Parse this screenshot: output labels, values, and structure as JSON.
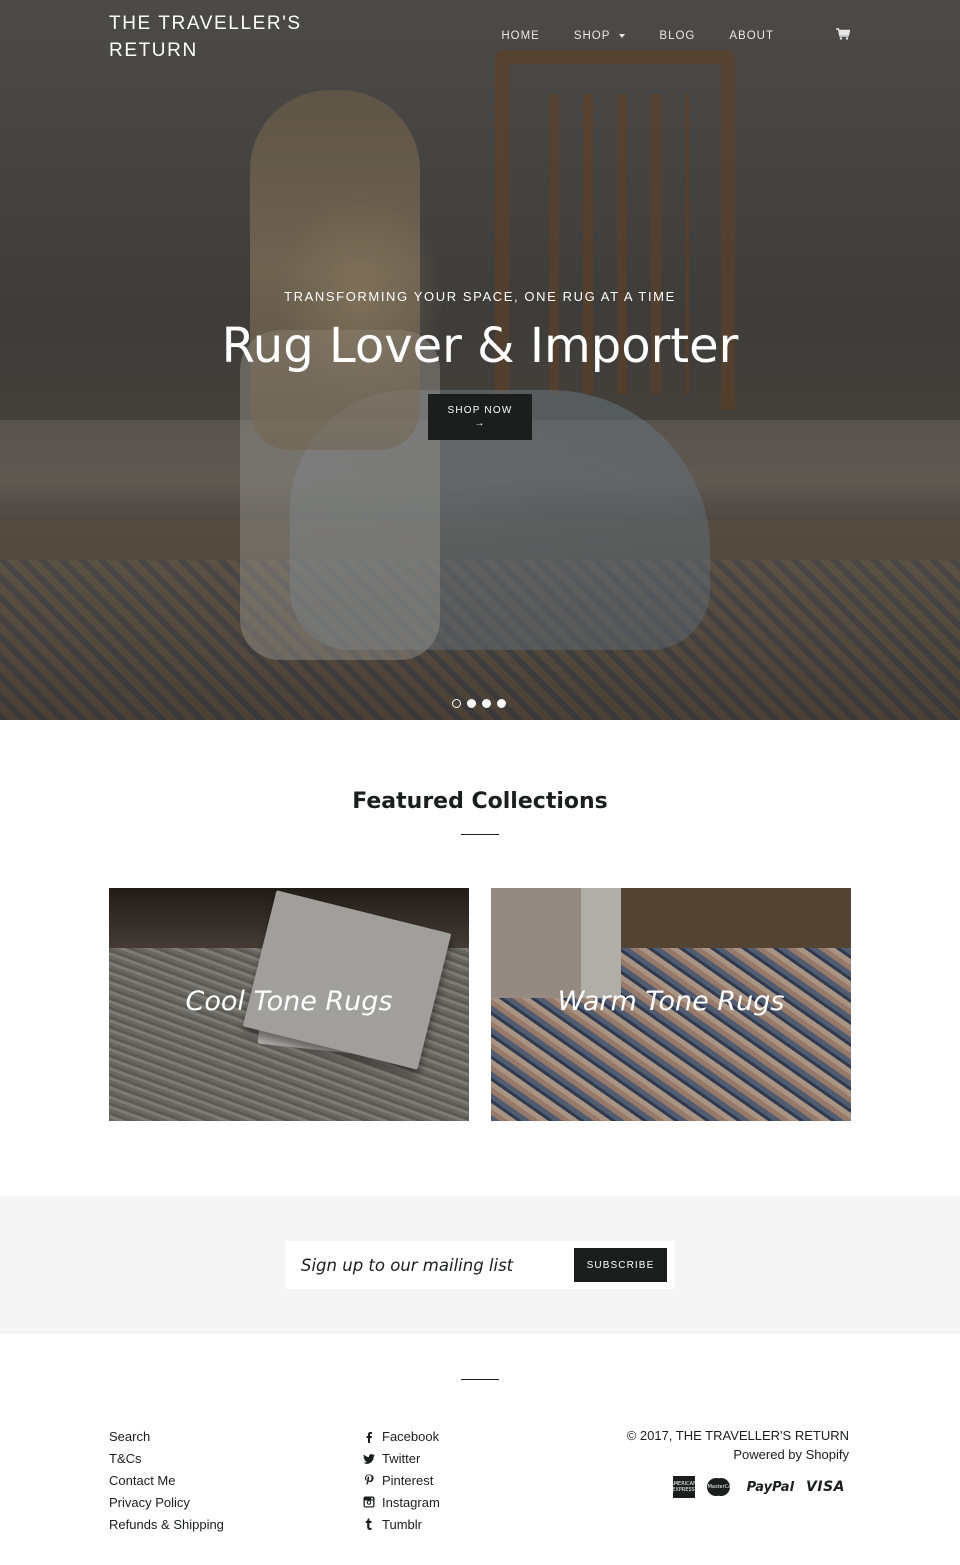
{
  "header": {
    "logo": "THE TRAVELLER'S RETURN",
    "nav": [
      {
        "label": "HOME"
      },
      {
        "label": "SHOP"
      },
      {
        "label": "BLOG"
      },
      {
        "label": "ABOUT"
      }
    ],
    "cart_icon": "cart-icon"
  },
  "hero": {
    "subtitle": "TRANSFORMING YOUR SPACE, ONE RUG AT A TIME",
    "title": "Rug Lover & Importer",
    "button_label": "SHOP NOW",
    "button_arrow": "→",
    "slide_count": 4,
    "active_slide": 1
  },
  "featured": {
    "title": "Featured Collections",
    "collections": [
      {
        "label": "Cool Tone Rugs"
      },
      {
        "label": "Warm Tone Rugs"
      }
    ]
  },
  "newsletter": {
    "placeholder": "Sign up to our mailing list",
    "button_label": "SUBSCRIBE"
  },
  "footer": {
    "links": [
      "Search",
      "T&Cs",
      "Contact Me",
      "Privacy Policy",
      "Refunds & Shipping"
    ],
    "social": [
      {
        "label": "Facebook",
        "icon": "facebook-icon"
      },
      {
        "label": "Twitter",
        "icon": "twitter-icon"
      },
      {
        "label": "Pinterest",
        "icon": "pinterest-icon"
      },
      {
        "label": "Instagram",
        "icon": "instagram-icon"
      },
      {
        "label": "Tumblr",
        "icon": "tumblr-icon"
      }
    ],
    "copyright": "© 2017, THE TRAVELLER'S RETURN",
    "powered_by": "Powered by Shopify",
    "payments": {
      "amex": "AMERICAN EXPRESS",
      "mastercard": "MasterCard",
      "paypal": "PayPal",
      "visa": "VISA"
    }
  },
  "colors": {
    "dark": "#1c1d1d",
    "newsletter_bg": "#f5f5f5",
    "white": "#ffffff"
  }
}
